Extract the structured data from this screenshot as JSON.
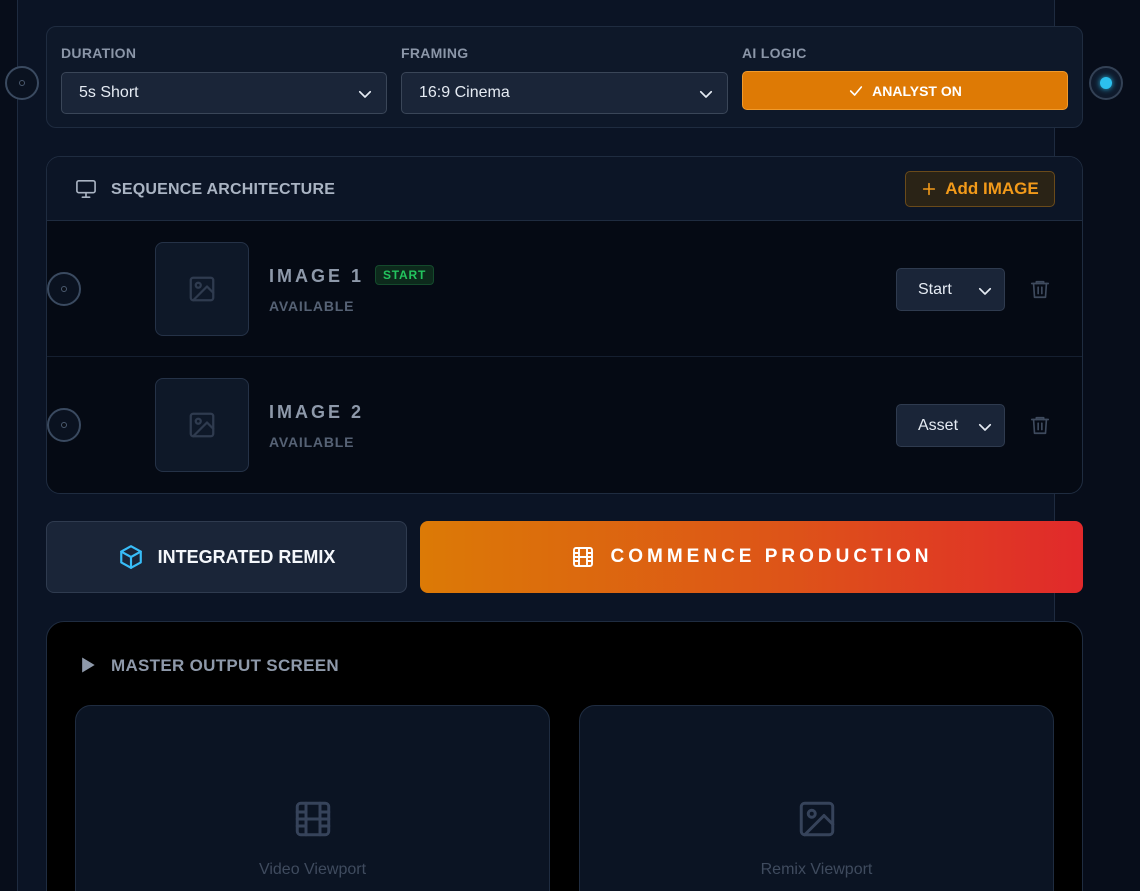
{
  "settings": {
    "duration": {
      "label": "DURATION",
      "value": "5s Short"
    },
    "framing": {
      "label": "FRAMING",
      "value": "16:9 Cinema"
    },
    "ai_logic": {
      "label": "AI LOGIC",
      "button_label": "ANALYST ON"
    }
  },
  "sequence": {
    "title": "SEQUENCE ARCHITECTURE",
    "add_label": "Add IMAGE",
    "items": [
      {
        "title": "IMAGE 1",
        "badge": "START",
        "status": "AVAILABLE",
        "role": "Start"
      },
      {
        "title": "IMAGE 2",
        "status": "AVAILABLE",
        "role": "Asset"
      }
    ]
  },
  "actions": {
    "remix_label": "INTEGRATED REMIX",
    "produce_label": "COMMENCE PRODUCTION"
  },
  "master": {
    "title": "MASTER OUTPUT SCREEN",
    "video_viewport_label": "Video Viewport",
    "remix_viewport_label": "Remix Viewport"
  },
  "colors": {
    "accent_orange": "#de7a05",
    "accent_red": "#e1292b",
    "cyan": "#2cc0ee",
    "success_green": "#23c45e"
  }
}
